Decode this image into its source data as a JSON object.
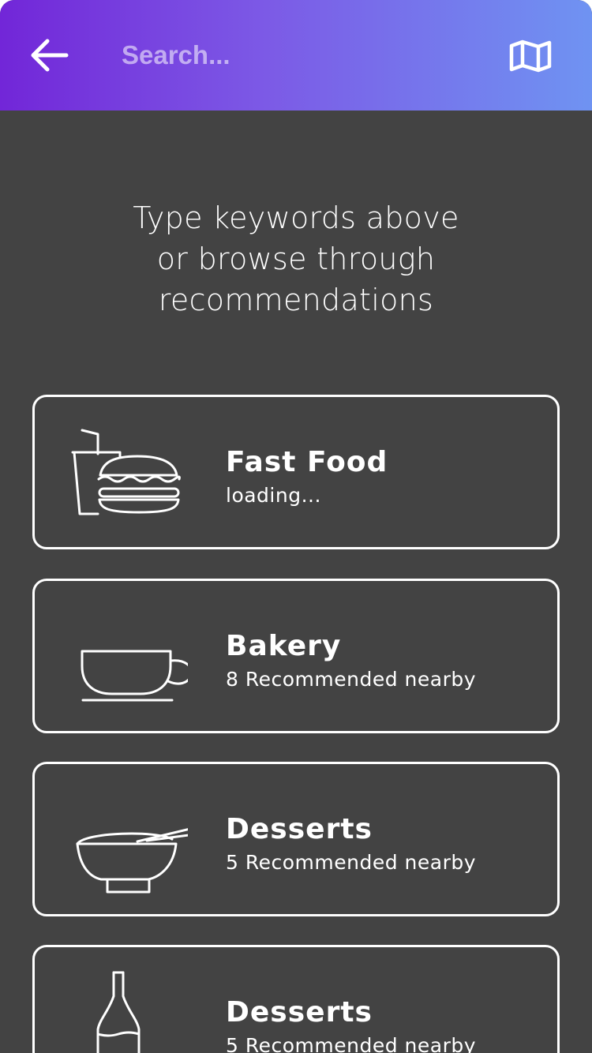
{
  "header": {
    "back_icon": "arrow-left-icon",
    "search_placeholder": "Search...",
    "search_value": "",
    "map_icon": "map-icon",
    "gradient_start": "#7226d8",
    "gradient_end": "#6f93f2"
  },
  "prompt": {
    "lines": [
      "Type keywords above",
      "or browse through",
      "recommendations"
    ]
  },
  "categories": [
    {
      "title": "Fast Food",
      "subtitle": "loading...",
      "icon": "burger-drink-icon"
    },
    {
      "title": "Bakery",
      "subtitle": "8 Recommended nearby",
      "icon": "coffee-cup-icon"
    },
    {
      "title": "Desserts",
      "subtitle": "5 Recommended nearby",
      "icon": "bowl-chopsticks-icon"
    },
    {
      "title": "Desserts",
      "subtitle": "5 Recommended nearby",
      "icon": "bottle-icon"
    }
  ],
  "colors": {
    "background": "#434343",
    "card_border": "#ffffff",
    "text": "#ffffff"
  }
}
